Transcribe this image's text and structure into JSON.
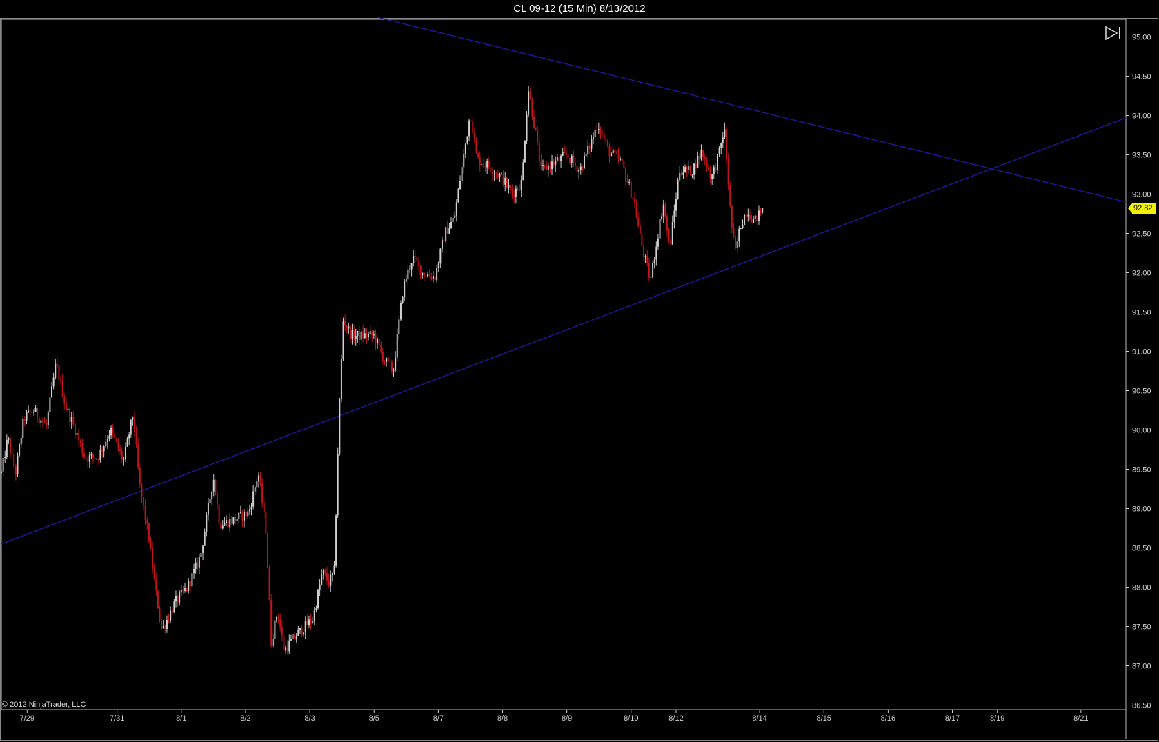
{
  "window": {
    "title": "CL 09-12 (15 Min)  8/13/2012"
  },
  "copyright": "© 2012 NinjaTrader, LLC",
  "last_price": "92.82",
  "colors": {
    "background": "#000000",
    "up_bar": "#d0d0d0",
    "down_bar": "#c0151a",
    "trendline": "#1a1aa0",
    "axis": "#cfcfcf",
    "price_tag": "#f2f200"
  },
  "icons": {
    "scroll_end": "scroll-to-end-icon"
  },
  "chart_data": {
    "type": "candlestick",
    "title": "CL 09-12 (15 Min)  8/13/2012",
    "ylim": [
      86.5,
      95.1
    ],
    "y_ticks": [
      "95.00",
      "94.50",
      "94.00",
      "93.50",
      "93.00",
      "92.50",
      "92.00",
      "91.50",
      "91.00",
      "90.50",
      "90.00",
      "89.50",
      "89.00",
      "88.50",
      "88.00",
      "87.50",
      "87.00",
      "86.50"
    ],
    "x_ticks": [
      "7/29",
      "7/31",
      "8/1",
      "8/2",
      "8/3",
      "8/5",
      "8/7",
      "8/8",
      "8/9",
      "8/10",
      "8/12",
      "8/14",
      "8/15",
      "8/16",
      "8/17",
      "8/19",
      "8/21"
    ],
    "x_tick_session_index": [
      0.4,
      1.8,
      2.8,
      3.8,
      4.8,
      5.8,
      6.8,
      7.8,
      8.8,
      9.8,
      10.5,
      11.8,
      12.8,
      13.8,
      14.8,
      15.5,
      16.8
    ],
    "x_range_sessions": [
      0,
      17.5
    ],
    "price_path": [
      {
        "t": 0.0,
        "p": 89.45
      },
      {
        "t": 0.1,
        "p": 89.9
      },
      {
        "t": 0.22,
        "p": 89.45
      },
      {
        "t": 0.35,
        "p": 90.15
      },
      {
        "t": 0.5,
        "p": 90.25
      },
      {
        "t": 0.7,
        "p": 90.05
      },
      {
        "t": 0.85,
        "p": 90.85
      },
      {
        "t": 1.0,
        "p": 90.3
      },
      {
        "t": 1.15,
        "p": 90.0
      },
      {
        "t": 1.3,
        "p": 89.65
      },
      {
        "t": 1.5,
        "p": 89.65
      },
      {
        "t": 1.7,
        "p": 90.0
      },
      {
        "t": 1.9,
        "p": 89.6
      },
      {
        "t": 2.05,
        "p": 90.2
      },
      {
        "t": 2.15,
        "p": 89.3
      },
      {
        "t": 2.3,
        "p": 88.6
      },
      {
        "t": 2.4,
        "p": 87.95
      },
      {
        "t": 2.5,
        "p": 87.45
      },
      {
        "t": 2.7,
        "p": 87.8
      },
      {
        "t": 2.9,
        "p": 88.0
      },
      {
        "t": 3.1,
        "p": 88.4
      },
      {
        "t": 3.3,
        "p": 89.4
      },
      {
        "t": 3.4,
        "p": 88.8
      },
      {
        "t": 3.6,
        "p": 88.85
      },
      {
        "t": 3.85,
        "p": 88.95
      },
      {
        "t": 4.0,
        "p": 89.45
      },
      {
        "t": 4.12,
        "p": 88.7
      },
      {
        "t": 4.2,
        "p": 87.3
      },
      {
        "t": 4.3,
        "p": 87.7
      },
      {
        "t": 4.4,
        "p": 87.2
      },
      {
        "t": 4.6,
        "p": 87.4
      },
      {
        "t": 4.85,
        "p": 87.6
      },
      {
        "t": 5.0,
        "p": 88.2
      },
      {
        "t": 5.1,
        "p": 88.05
      },
      {
        "t": 5.18,
        "p": 88.2
      },
      {
        "t": 5.25,
        "p": 90.1
      },
      {
        "t": 5.32,
        "p": 91.4
      },
      {
        "t": 5.45,
        "p": 91.2
      },
      {
        "t": 5.6,
        "p": 91.2
      },
      {
        "t": 5.8,
        "p": 91.2
      },
      {
        "t": 5.95,
        "p": 90.9
      },
      {
        "t": 6.1,
        "p": 90.75
      },
      {
        "t": 6.25,
        "p": 91.8
      },
      {
        "t": 6.4,
        "p": 92.2
      },
      {
        "t": 6.55,
        "p": 92.0
      },
      {
        "t": 6.75,
        "p": 91.95
      },
      {
        "t": 6.9,
        "p": 92.5
      },
      {
        "t": 7.05,
        "p": 92.7
      },
      {
        "t": 7.18,
        "p": 93.4
      },
      {
        "t": 7.3,
        "p": 94.05
      },
      {
        "t": 7.4,
        "p": 93.45
      },
      {
        "t": 7.6,
        "p": 93.35
      },
      {
        "t": 7.8,
        "p": 93.2
      },
      {
        "t": 7.95,
        "p": 93.0
      },
      {
        "t": 8.1,
        "p": 93.15
      },
      {
        "t": 8.2,
        "p": 94.35
      },
      {
        "t": 8.3,
        "p": 93.85
      },
      {
        "t": 8.4,
        "p": 93.3
      },
      {
        "t": 8.6,
        "p": 93.4
      },
      {
        "t": 8.8,
        "p": 93.5
      },
      {
        "t": 9.0,
        "p": 93.3
      },
      {
        "t": 9.15,
        "p": 93.6
      },
      {
        "t": 9.28,
        "p": 93.9
      },
      {
        "t": 9.45,
        "p": 93.55
      },
      {
        "t": 9.65,
        "p": 93.4
      },
      {
        "t": 9.85,
        "p": 92.9
      },
      {
        "t": 9.95,
        "p": 92.4
      },
      {
        "t": 10.1,
        "p": 91.9
      },
      {
        "t": 10.2,
        "p": 92.4
      },
      {
        "t": 10.3,
        "p": 92.9
      },
      {
        "t": 10.4,
        "p": 92.3
      },
      {
        "t": 10.55,
        "p": 93.3
      },
      {
        "t": 10.75,
        "p": 93.3
      },
      {
        "t": 10.9,
        "p": 93.55
      },
      {
        "t": 11.05,
        "p": 93.2
      },
      {
        "t": 11.18,
        "p": 93.55
      },
      {
        "t": 11.25,
        "p": 93.85
      },
      {
        "t": 11.35,
        "p": 92.7
      },
      {
        "t": 11.42,
        "p": 92.25
      },
      {
        "t": 11.5,
        "p": 92.6
      },
      {
        "t": 11.6,
        "p": 92.8
      },
      {
        "t": 11.72,
        "p": 92.65
      },
      {
        "t": 11.85,
        "p": 92.82
      }
    ],
    "trendlines": [
      {
        "name": "",
        "points": [
          {
            "t": 5.85,
            "p": 95.25
          },
          {
            "t": 17.5,
            "p": 92.9
          }
        ]
      },
      {
        "name": "",
        "points": [
          {
            "t": 0.0,
            "p": 88.55
          },
          {
            "t": 17.5,
            "p": 93.97
          }
        ]
      }
    ],
    "last_value": 92.82,
    "grid": false
  }
}
